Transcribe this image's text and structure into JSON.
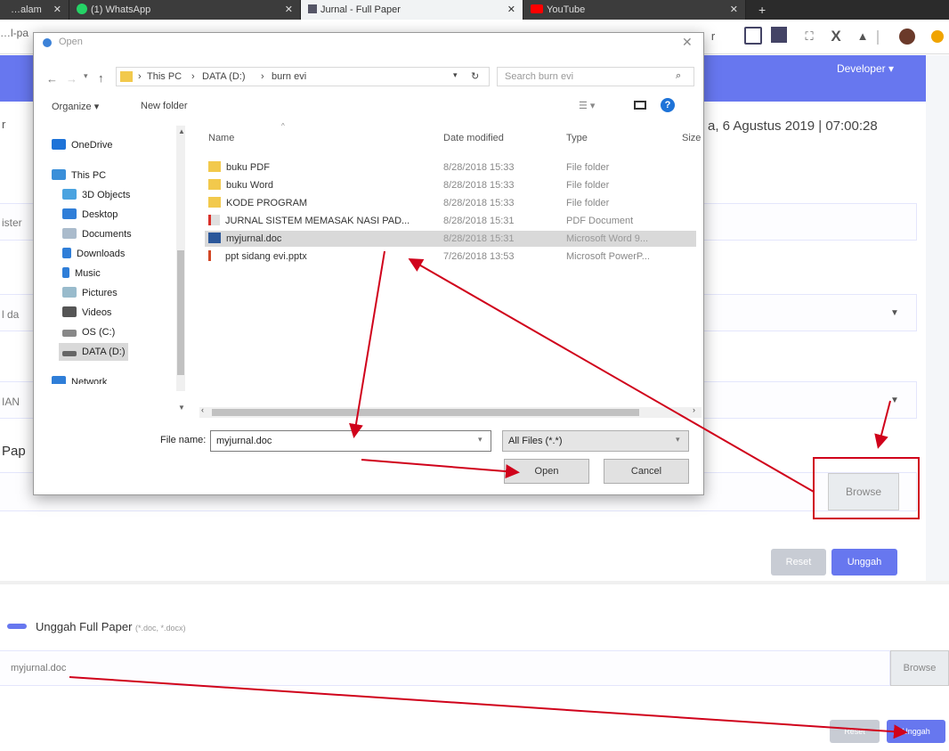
{
  "browser": {
    "tabs": [
      {
        "label": "…alam",
        "active": false
      },
      {
        "label": "(1) WhatsApp",
        "active": false
      },
      {
        "label": "Jurnal - Full Paper",
        "active": true
      },
      {
        "label": "YouTube",
        "active": false
      }
    ],
    "address_fragment": "…l-pa"
  },
  "page": {
    "user_menu": "Developer ▾",
    "date_text": "a, 6 Agustus 2019 | 07:00:28",
    "left_label_1": "r",
    "left_label_2": "ister",
    "left_label_3": "l da",
    "left_label_4": "IAN",
    "section_label": "Pap",
    "browse_label": "Browse",
    "reset_label": "Reset",
    "upload_label": "Unggah"
  },
  "dialog": {
    "title": "Open",
    "breadcrumb": [
      "This PC",
      "DATA (D:)",
      "burn evi"
    ],
    "search_placeholder": "Search burn evi",
    "organize_label": "Organize ▾",
    "new_folder_label": "New folder",
    "nav_items": [
      {
        "label": "OneDrive",
        "color": "#1e73d8"
      },
      {
        "label": "This PC",
        "color": "#3a8fd9"
      },
      {
        "label": "3D Objects",
        "color": "#4aa3e0"
      },
      {
        "label": "Desktop",
        "color": "#2f7ed8"
      },
      {
        "label": "Documents",
        "color": "#9ab"
      },
      {
        "label": "Downloads",
        "color": "#2f7ed8"
      },
      {
        "label": "Music",
        "color": "#2f7ed8"
      },
      {
        "label": "Pictures",
        "color": "#9bc"
      },
      {
        "label": "Videos",
        "color": "#555"
      },
      {
        "label": "OS (C:)",
        "color": "#888"
      },
      {
        "label": "DATA (D:)",
        "color": "#666"
      },
      {
        "label": "Network",
        "color": "#2f7ed8"
      }
    ],
    "columns": [
      "Name",
      "Date modified",
      "Type",
      "Size"
    ],
    "files": [
      {
        "name": "buku PDF",
        "date": "8/28/2018 15:33",
        "type": "File folder",
        "icon": "folder"
      },
      {
        "name": "buku Word",
        "date": "8/28/2018 15:33",
        "type": "File folder",
        "icon": "folder"
      },
      {
        "name": "KODE PROGRAM",
        "date": "8/28/2018 15:33",
        "type": "File folder",
        "icon": "folder"
      },
      {
        "name": "JURNAL SISTEM MEMASAK NASI PAD...",
        "date": "8/28/2018 15:31",
        "type": "PDF Document",
        "icon": "pdf"
      },
      {
        "name": "myjurnal.doc",
        "date": "8/28/2018 15:31",
        "type": "Microsoft Word 9...",
        "icon": "word",
        "selected": true
      },
      {
        "name": "ppt sidang evi.pptx",
        "date": "7/26/2018 13:53",
        "type": "Microsoft PowerP...",
        "icon": "ppt"
      }
    ],
    "filename_label": "File name:",
    "filename_value": "myjurnal.doc",
    "filetype_value": "All Files (*.*)",
    "open_label": "Open",
    "cancel_label": "Cancel"
  },
  "lower": {
    "title": "Unggah Full Paper",
    "hint": "(*.doc, *.docx)",
    "file_value": "myjurnal.doc",
    "browse_label": "Browse",
    "reset_label": "Reset",
    "upload_label": "Unggah"
  },
  "colors": {
    "accent": "#6777ef",
    "annotation": "#d0021b"
  }
}
